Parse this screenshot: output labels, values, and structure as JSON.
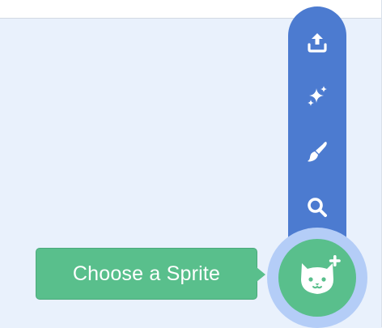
{
  "tooltip": {
    "label": "Choose a Sprite"
  },
  "sprite_menu": {
    "items": [
      {
        "name": "upload-sprite",
        "icon": "upload-icon"
      },
      {
        "name": "surprise",
        "icon": "sparkles-icon"
      },
      {
        "name": "paint",
        "icon": "paintbrush-icon"
      },
      {
        "name": "choose",
        "icon": "search-icon"
      }
    ],
    "main_button": {
      "icon": "cat-plus-icon"
    }
  },
  "colors": {
    "menu": "#4c7bd0",
    "accent_green": "#59bf8c",
    "halo": "#b4cdf7",
    "background": "#e9f1fc"
  }
}
